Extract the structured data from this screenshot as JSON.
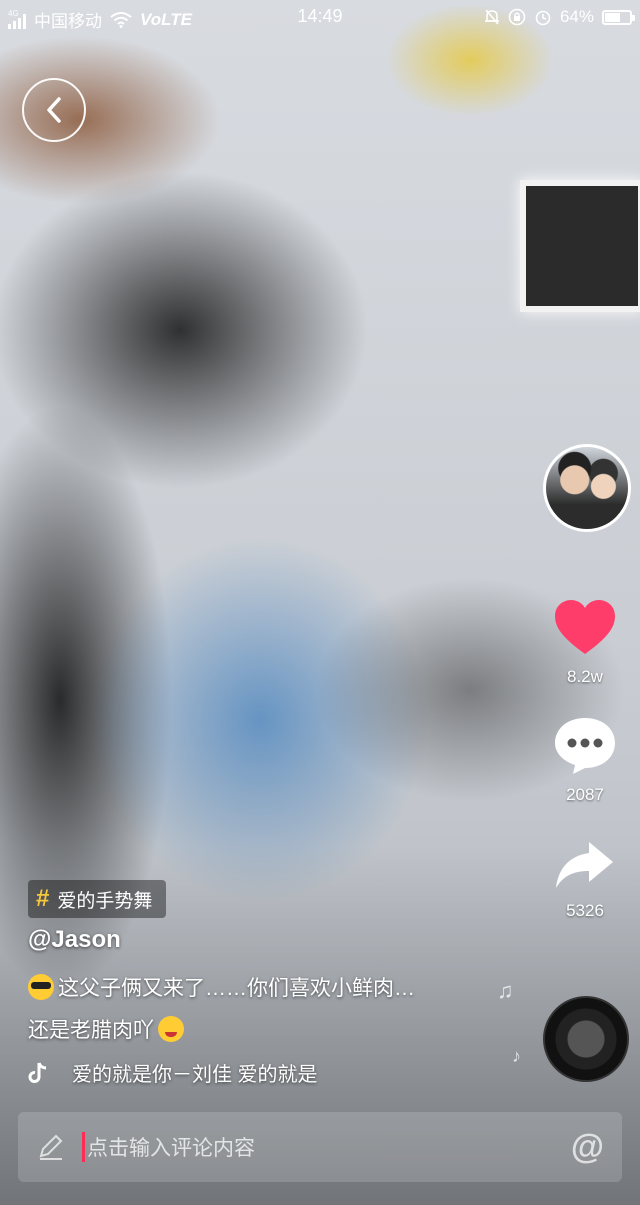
{
  "status_bar": {
    "network_tag": "4G",
    "carrier": "中国移动",
    "volte": "VoLTE",
    "time": "14:49",
    "battery_percent": "64%",
    "battery_level": 0.64
  },
  "sidebar": {
    "like_count": "8.2w",
    "comment_count": "2087",
    "share_count": "5326",
    "like_color": "#ff3d6a"
  },
  "caption": {
    "hashtag": "爱的手势舞",
    "username": "@Jason",
    "line1": "这父子俩又来了……你们喜欢小鲜肉…",
    "line2": "还是老腊肉吖"
  },
  "music": {
    "title": "爱的就是你－刘佳   爱的就是"
  },
  "comment_bar": {
    "placeholder": "点击输入评论内容"
  }
}
